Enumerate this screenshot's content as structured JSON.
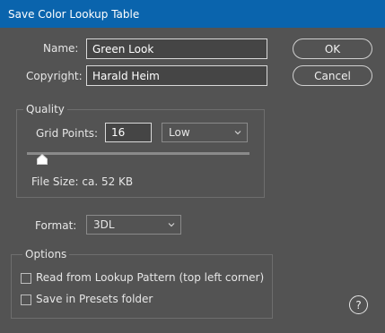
{
  "window": {
    "title": "Save Color Lookup Table"
  },
  "fields": {
    "name_label": "Name:",
    "name_value": "Green Look",
    "copyright_label": "Copyright:",
    "copyright_value": "Harald Heim"
  },
  "buttons": {
    "ok": "OK",
    "cancel": "Cancel",
    "help": "?"
  },
  "quality": {
    "legend": "Quality",
    "grid_points_label": "Grid Points:",
    "grid_points_value": "16",
    "preset_selected": "Low",
    "slider_level": 0.05,
    "file_size": "File Size: ca. 52 KB"
  },
  "format": {
    "label": "Format:",
    "selected": "3DL"
  },
  "options": {
    "legend": "Options",
    "read_from_pattern": {
      "label": "Read from Lookup Pattern (top left corner)",
      "checked": false
    },
    "save_in_presets": {
      "label": "Save in Presets folder",
      "checked": false
    }
  },
  "colors": {
    "titlebar": "#0a64ad",
    "background": "#535353"
  },
  "icons": {
    "dropdown": "chevron-down-icon",
    "slider_thumb": "slider-thumb-icon",
    "help": "help-icon"
  }
}
